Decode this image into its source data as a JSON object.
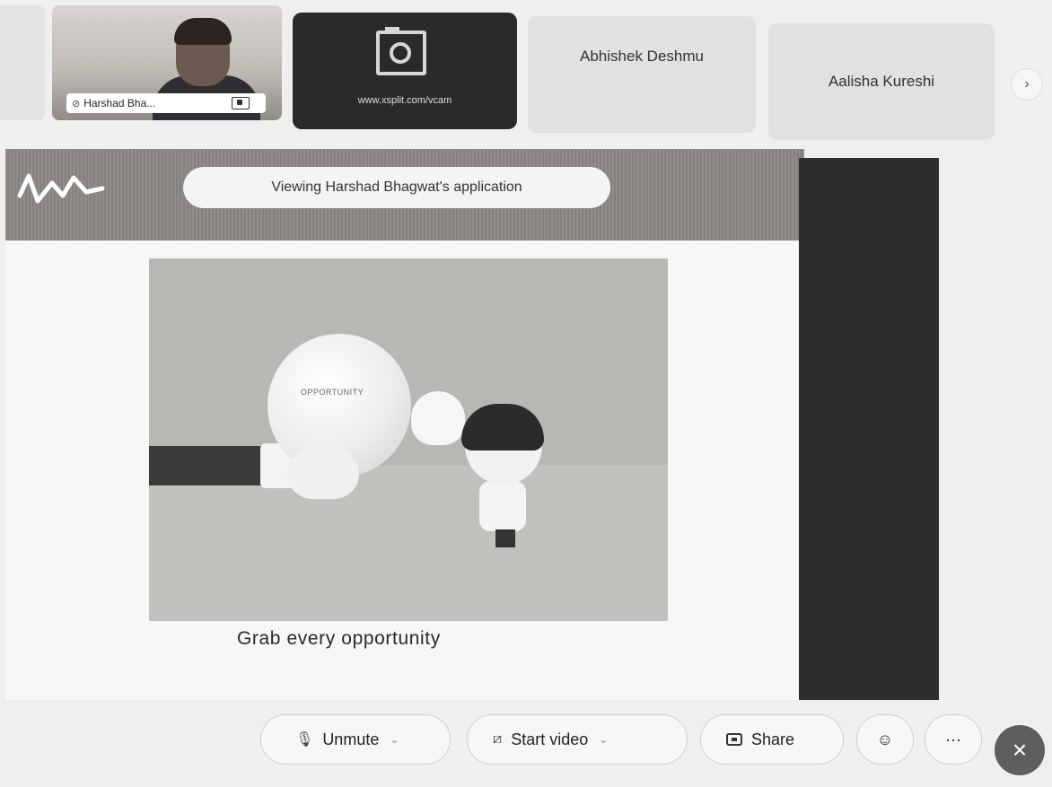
{
  "participants": {
    "harshad_label": "Harshad Bha...",
    "cam_tile_url": "www.xsplit.com/vcam",
    "abhishek_name": "Abhishek Deshmu",
    "aalisha_name": "Aalisha Kureshi",
    "next_icon": "›"
  },
  "share_bar": {
    "viewing_text": "Viewing Harshad Bhagwat's application"
  },
  "slide": {
    "globe_label": "OPPORTUNITY",
    "caption": "Grab every opportunity"
  },
  "controls": {
    "unmute_label": "Unmute",
    "start_video_label": "Start video",
    "share_label": "Share",
    "more_label": "···",
    "leave_label": "×"
  }
}
